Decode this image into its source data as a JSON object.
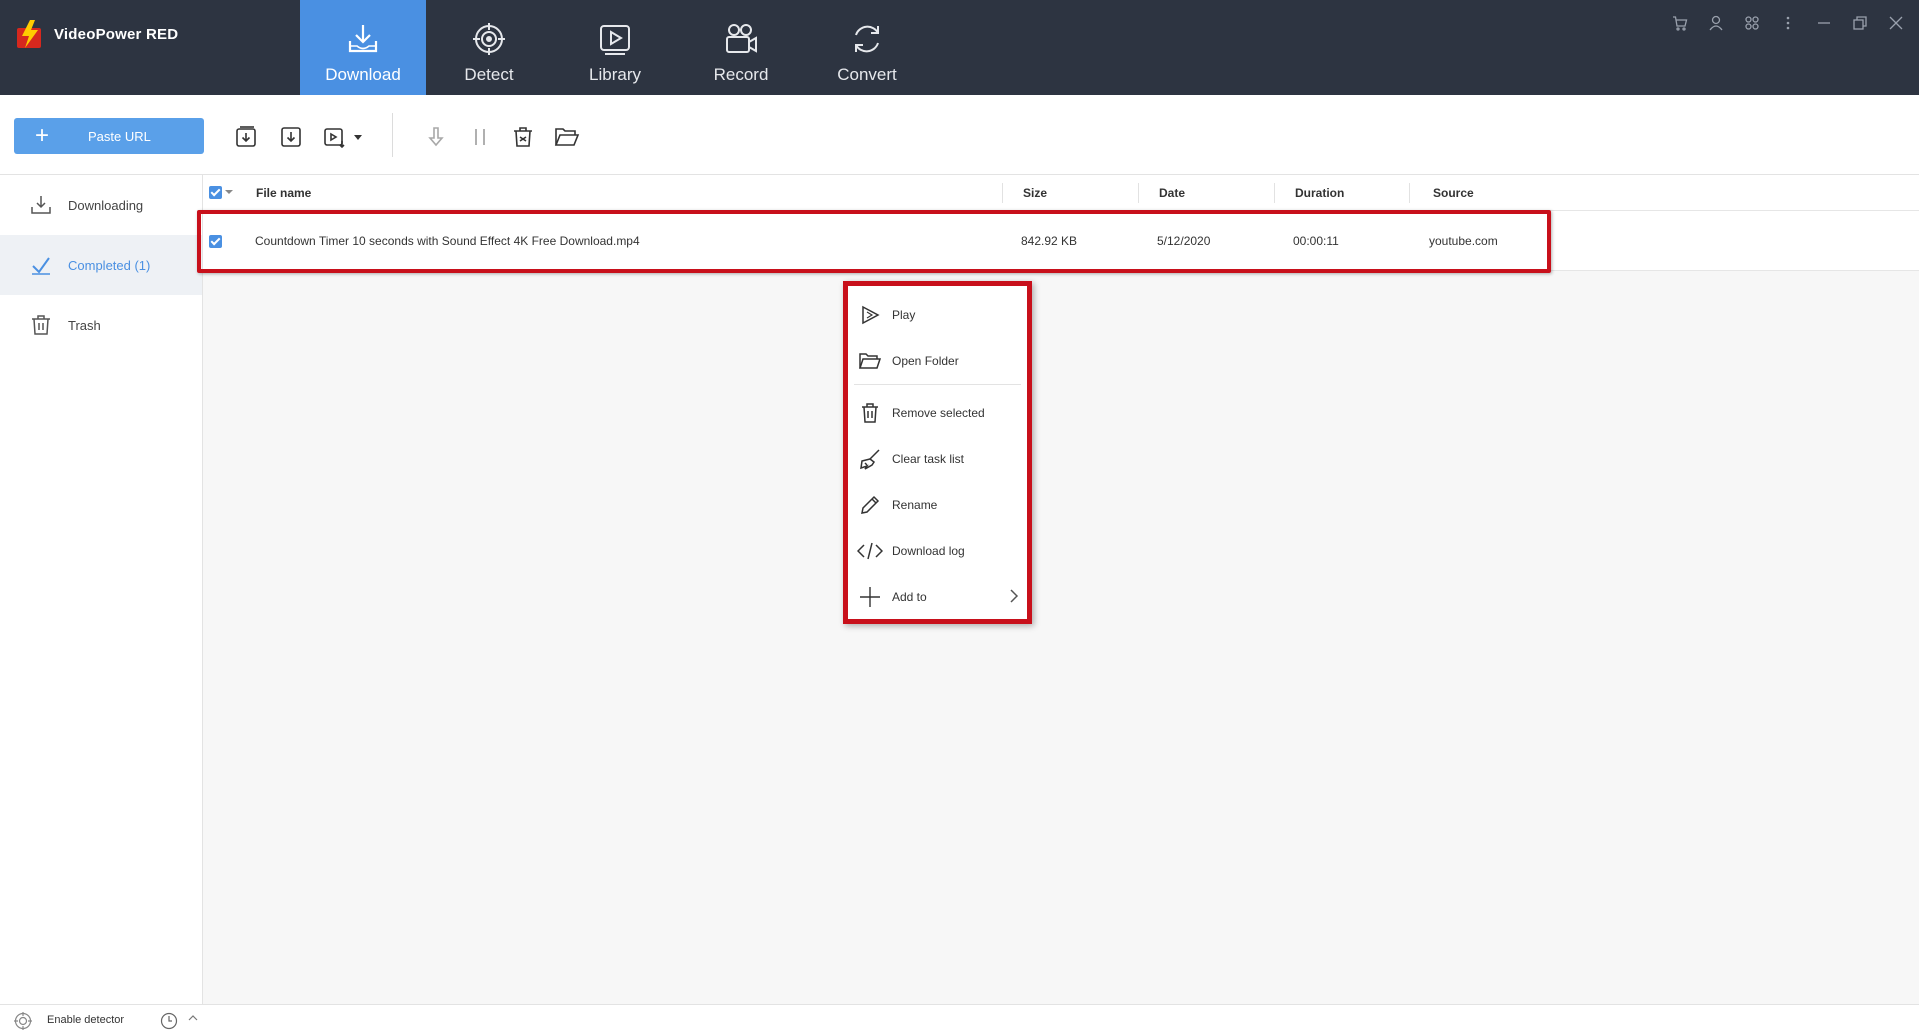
{
  "app": {
    "title": "VideoPower RED"
  },
  "nav": {
    "tabs": [
      {
        "label": "Download",
        "icon": "download-tray-icon",
        "active": true
      },
      {
        "label": "Detect",
        "icon": "detect-target-icon",
        "active": false
      },
      {
        "label": "Library",
        "icon": "library-play-icon",
        "active": false
      },
      {
        "label": "Record",
        "icon": "record-camera-icon",
        "active": false
      },
      {
        "label": "Convert",
        "icon": "convert-cycle-icon",
        "active": false
      }
    ]
  },
  "window_controls": [
    "cart-icon",
    "user-icon",
    "apps-icon",
    "more-icon",
    "minimize-icon",
    "restore-icon",
    "close-icon"
  ],
  "toolbar": {
    "paste_url_label": "Paste URL",
    "icons": [
      "download-list-icon",
      "download-single-icon",
      "video-download-icon",
      "dropdown-icon",
      "resume-icon",
      "pause-icon",
      "delete-icon",
      "open-folder-icon"
    ]
  },
  "sidebar": {
    "items": [
      {
        "label": "Downloading",
        "icon": "downloading-icon",
        "active": false
      },
      {
        "label": "Completed (1)",
        "icon": "checkmark-icon",
        "active": true
      },
      {
        "label": "Trash",
        "icon": "trash-icon",
        "active": false
      }
    ]
  },
  "table": {
    "columns": [
      "File name",
      "Size",
      "Date",
      "Duration",
      "Source"
    ],
    "rows": [
      {
        "checked": true,
        "file_name": "Countdown Timer 10 seconds with Sound Effect 4K Free Download.mp4",
        "size": "842.92 KB",
        "date": "5/12/2020",
        "duration": "00:00:11",
        "source": "youtube.com"
      }
    ]
  },
  "context_menu": {
    "items": [
      {
        "label": "Play",
        "icon": "play-icon"
      },
      {
        "label": "Open Folder",
        "icon": "folder-icon"
      },
      {
        "label": "Remove selected",
        "icon": "trash-icon"
      },
      {
        "label": "Clear task list",
        "icon": "broom-icon"
      },
      {
        "label": "Rename",
        "icon": "pencil-icon"
      },
      {
        "label": "Download log",
        "icon": "code-icon"
      },
      {
        "label": "Add to",
        "icon": "plus-icon",
        "submenu": true
      }
    ]
  },
  "status_bar": {
    "enable_detector_label": "Enable detector"
  },
  "colors": {
    "header_bg": "#2d3441",
    "accent": "#4a90e2",
    "highlight": "#c8101b"
  }
}
